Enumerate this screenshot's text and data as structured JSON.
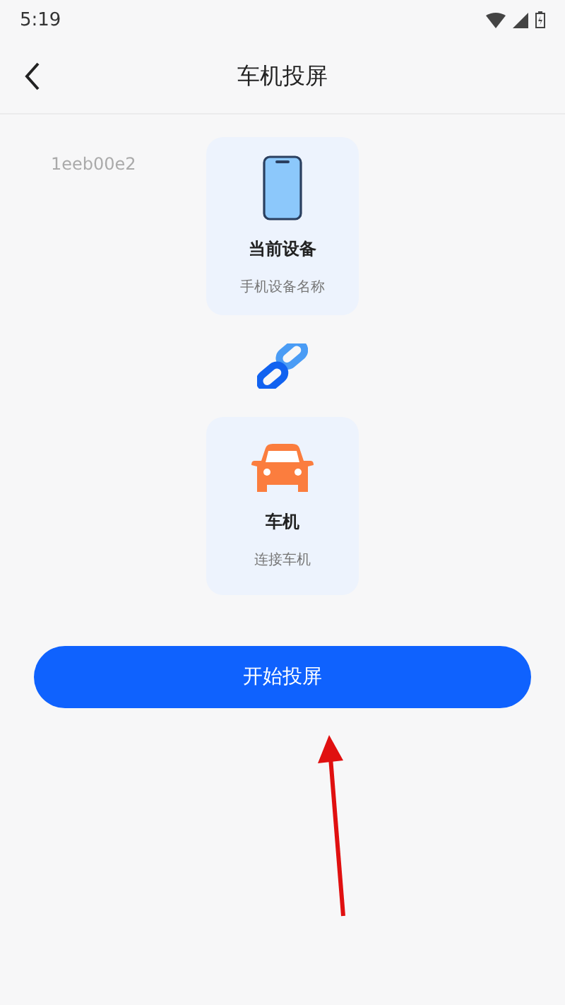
{
  "status_bar": {
    "time": "5:19"
  },
  "header": {
    "title": "车机投屏"
  },
  "device_id": "1eeb00e2",
  "devices": [
    {
      "kind": "phone",
      "title": "当前设备",
      "subtitle": "手机设备名称"
    },
    {
      "kind": "car",
      "title": "车机",
      "subtitle": "连接车机"
    }
  ],
  "start_button": "开始投屏"
}
